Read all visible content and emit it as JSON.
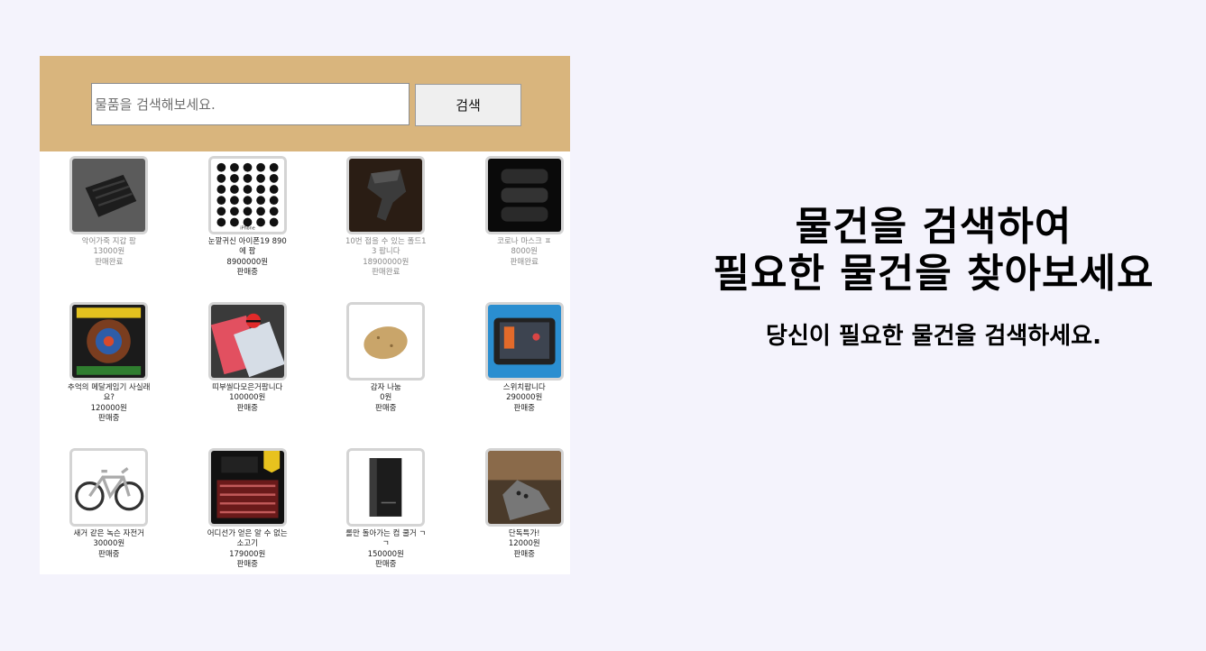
{
  "search": {
    "placeholder": "물품을 검색해보세요.",
    "button_label": "검색"
  },
  "products": [
    {
      "name": "악어가죽 지갑 팜",
      "price": "13000원",
      "status": "판매완료",
      "sold": true,
      "icon": "wallet-image"
    },
    {
      "name": "눈깔귀신 아이폰19 890에 팜",
      "price": "8900000원",
      "status": "판매중",
      "sold": false,
      "icon": "phone-camera-grid-image"
    },
    {
      "name": "10번 접을 수 있는 폴드13 팝니다",
      "price": "18900000원",
      "status": "판매완료",
      "sold": true,
      "icon": "folded-phone-image"
    },
    {
      "name": "코로나 마스크 ㅍ",
      "price": "8000원",
      "status": "판매완료",
      "sold": true,
      "icon": "mask-image"
    },
    {
      "name": "추억의 메달게임기 사실래요?",
      "price": "120000원",
      "status": "판매중",
      "sold": false,
      "icon": "medal-game-machine-image"
    },
    {
      "name": "띠부씰다모은거팜니다",
      "price": "100000원",
      "status": "판매중",
      "sold": false,
      "icon": "sticker-album-image"
    },
    {
      "name": "감자 나눔",
      "price": "0원",
      "status": "판매중",
      "sold": false,
      "icon": "potato-image"
    },
    {
      "name": "스위치팝니다",
      "price": "290000원",
      "status": "판매중",
      "sold": false,
      "icon": "game-console-image"
    },
    {
      "name": "새거 같은 녹슨 자전거",
      "price": "30000원",
      "status": "판매중",
      "sold": false,
      "icon": "bicycle-image"
    },
    {
      "name": "어디선가 얻은 알 수 없는 소고기",
      "price": "179000원",
      "status": "판매중",
      "sold": false,
      "icon": "beef-box-image"
    },
    {
      "name": "롤만 돌아가는 컴 쿨거 ㄱㄱ",
      "price": "150000원",
      "status": "판매중",
      "sold": false,
      "icon": "pc-tower-image"
    },
    {
      "name": "단독특가!",
      "price": "12000원",
      "status": "판매중",
      "sold": false,
      "icon": "cat-photo-image"
    }
  ],
  "hero": {
    "title_line1": "물건을 검색하여",
    "title_line2": "필요한 물건을 찾아보세요",
    "subtitle": "당신이 필요한 물건을 검색하세요."
  },
  "colors": {
    "page_background": "#f4f3fc",
    "search_bar_background": "#d9b57d",
    "sold_text": "#8a8a8a",
    "thumb_border": "#d4d4d4"
  }
}
